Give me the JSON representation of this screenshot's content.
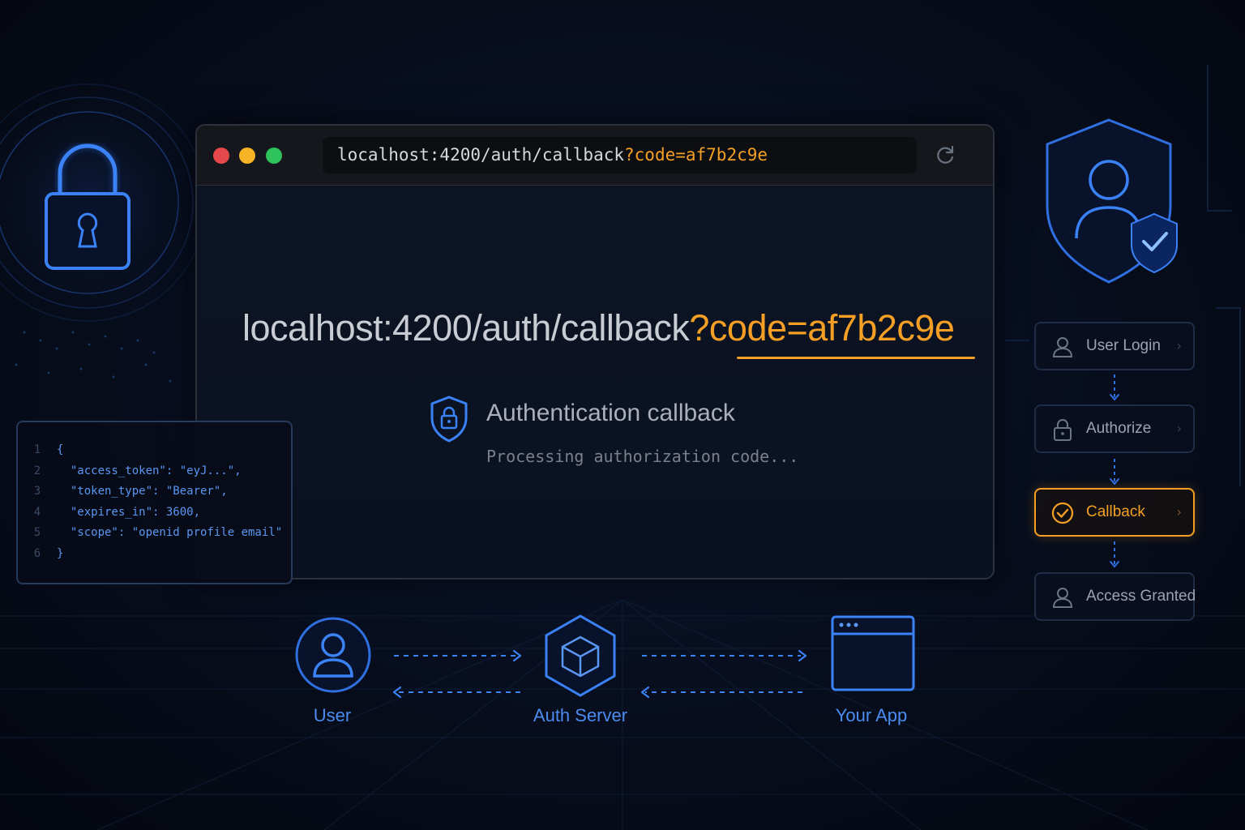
{
  "browser": {
    "url_base": "localhost:4200/auth/callback",
    "url_query": "?code=af7b2c9e"
  },
  "callback": {
    "url_base": "localhost:4200/auth/callback",
    "url_query": "?code=af7b2c9e",
    "title": "Authentication callback",
    "subtitle": "Processing authorization code..."
  },
  "code_panel": {
    "lines": [
      {
        "n": "1",
        "text": "{"
      },
      {
        "n": "2",
        "text": "  \"access_token\": \"eyJ...\","
      },
      {
        "n": "3",
        "text": "  \"token_type\": \"Bearer\","
      },
      {
        "n": "4",
        "text": "  \"expires_in\": 3600,"
      },
      {
        "n": "5",
        "text": "  \"scope\": \"openid profile email\""
      },
      {
        "n": "6",
        "text": "}"
      }
    ]
  },
  "steps": [
    {
      "label": "User Login",
      "icon": "user-icon",
      "active": false
    },
    {
      "label": "Authorize",
      "icon": "lock-icon",
      "active": false
    },
    {
      "label": "Callback",
      "icon": "check-circle-icon",
      "active": true
    },
    {
      "label": "Access Granted",
      "icon": "user-icon",
      "active": false
    }
  ],
  "flow": {
    "nodes": [
      {
        "label": "User",
        "icon": "user-icon"
      },
      {
        "label": "Auth Server",
        "icon": "cube-icon"
      },
      {
        "label": "Your App",
        "icon": "app-window-icon"
      }
    ]
  },
  "colors": {
    "accent_orange": "#f5a025",
    "accent_blue": "#3b82f6",
    "code_blue": "#5a97f2",
    "window_dot_red": "#e5484d",
    "window_dot_yellow": "#f5b325",
    "window_dot_green": "#30c25a"
  }
}
